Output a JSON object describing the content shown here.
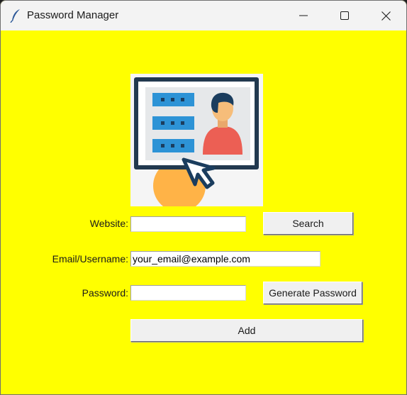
{
  "window": {
    "title": "Password Manager",
    "background": "#ffff00",
    "app_icon": "feather-icon",
    "controls": [
      "minimize-icon",
      "maximize-icon",
      "close-icon"
    ]
  },
  "logo": {
    "icon": "user-profile-screen-cursor-icon"
  },
  "form": {
    "website_label": "Website:",
    "website_value": "",
    "search_label": "Search",
    "email_label": "Email/Username:",
    "email_value": "your_email@example.com",
    "password_label": "Password:",
    "password_value": "",
    "generate_label": "Generate Password",
    "add_label": "Add"
  }
}
